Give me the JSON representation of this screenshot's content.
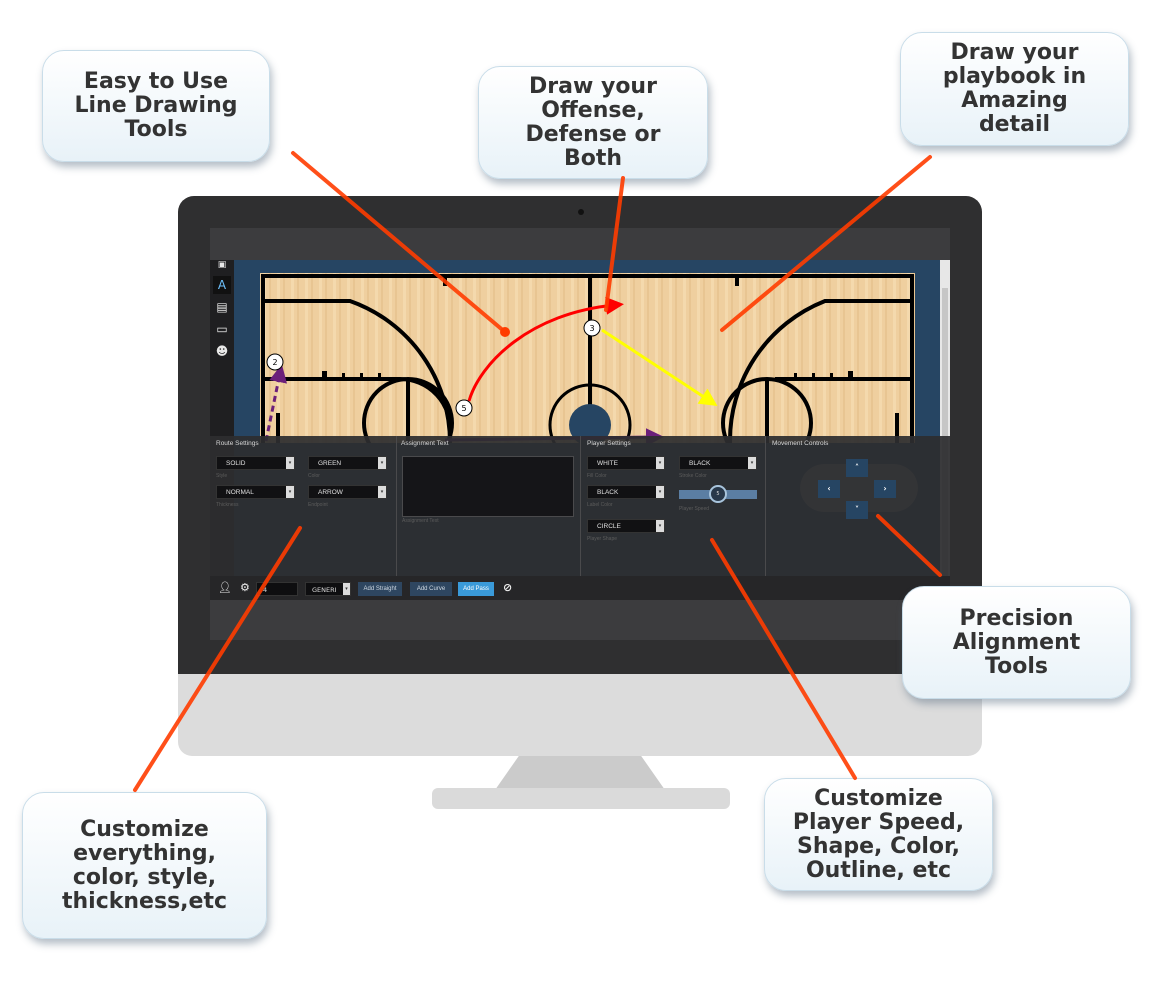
{
  "callouts": [
    {
      "id": "line-drawing",
      "text": "Easy to Use\nLine Drawing\nTools"
    },
    {
      "id": "offense-defense",
      "text": "Draw your\nOffense,\nDefense or\nBoth"
    },
    {
      "id": "amazing-detail",
      "text": "Draw your\nplaybook in\nAmazing\ndetail"
    },
    {
      "id": "precision",
      "text": "Precision\nAlignment\nTools"
    },
    {
      "id": "customize-everything",
      "text": "Customize\neverything,\ncolor, style,\nthickness,etc"
    },
    {
      "id": "player-speed",
      "text": "Customize\nPlayer Speed,\nShape, Color,\nOutline, etc"
    }
  ],
  "sidebar": {
    "items": [
      {
        "icon": "frame-icon",
        "label": "Frame"
      },
      {
        "icon": "draw-icon",
        "label": "Draw",
        "active": true
      },
      {
        "icon": "document-icon",
        "label": "Document"
      },
      {
        "icon": "monitor-icon",
        "label": "Display"
      },
      {
        "icon": "players-icon",
        "label": "Players"
      }
    ]
  },
  "court": {
    "players": [
      {
        "label": "2"
      },
      {
        "label": "5"
      },
      {
        "label": "3"
      }
    ],
    "routes": [
      {
        "from": "5",
        "color": "#ff0000",
        "style": "curve"
      },
      {
        "from": "3",
        "color": "#ffff00",
        "style": "straight"
      },
      {
        "from": "2",
        "color": "#6b1f7a",
        "style": "dashed"
      },
      {
        "color": "#6b1f7a",
        "style": "pass"
      }
    ]
  },
  "route_settings": {
    "title": "Route Settings",
    "style": {
      "value": "SOLID",
      "label": "Style"
    },
    "color": {
      "value": "GREEN",
      "label": "Color"
    },
    "thickness": {
      "value": "NORMAL",
      "label": "Thickness"
    },
    "endpoint": {
      "value": "ARROW",
      "label": "Endpoint"
    }
  },
  "assignment_text": {
    "title": "Assignment Text",
    "value": "",
    "label": "Assignment Text"
  },
  "player_settings": {
    "title": "Player Settings",
    "fill_color": {
      "value": "WHITE",
      "label": "Fill Color"
    },
    "stroke_color": {
      "value": "BLACK",
      "label": "Stroke Color"
    },
    "label_color": {
      "value": "BLACK",
      "label": "Label Color"
    },
    "player_speed": {
      "value": "5",
      "label": "Player Speed",
      "fraction": 0.5
    },
    "player_shape": {
      "value": "CIRCLE",
      "label": "Player Shape"
    }
  },
  "movement_controls": {
    "title": "Movement Controls",
    "up": "˄",
    "left": "‹",
    "right": "›",
    "down": "˅"
  },
  "toolbar": {
    "number_value": "4",
    "type_value": "GENERI",
    "add_straight": "Add Straight",
    "add_curve": "Add Curve",
    "add_pass": "Add Pass"
  },
  "colors": {
    "accent": "#3a9ad9",
    "court_border": "#264563",
    "scribble": "#ff3c00"
  }
}
